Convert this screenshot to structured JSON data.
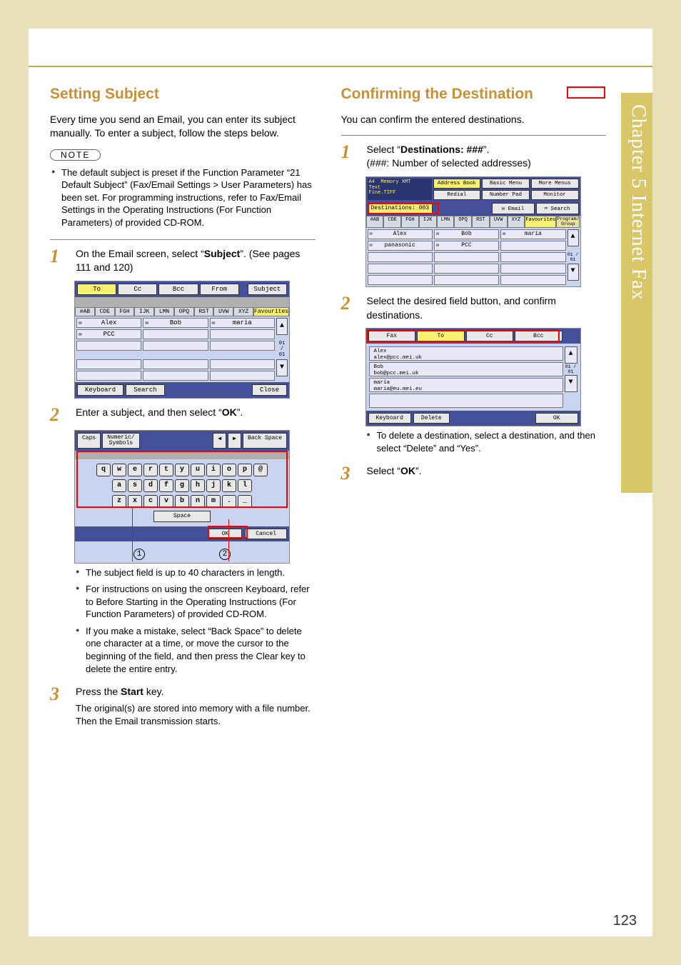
{
  "side_tab": "Chapter 5    Internet Fax",
  "page_number": "123",
  "left": {
    "heading": "Setting Subject",
    "intro": "Every time you send an Email, you can enter its subject manually. To enter a subject, follow the steps below.",
    "note_label": "NOTE",
    "note_bullets": [
      "The default subject is preset if the Function Parameter “21 Default Subject” (Fax/Email Settings > User Parameters) has been set. For programming instructions, refer to Fax/Email Settings in the Operating Instructions (For Function Parameters) of provided CD-ROM."
    ],
    "step1": {
      "num": "1",
      "text_pre": "On the Email screen, select “",
      "text_bold": "Subject",
      "text_post": "”. (See pages 111 and 120)"
    },
    "step2": {
      "num": "2",
      "text_pre": "Enter a subject, and then select “",
      "text_bold": "OK",
      "text_post": "”."
    },
    "step2_bullets": [
      "The subject field is up to 40 characters in length.",
      "For instructions on using the onscreen Keyboard, refer to Before Starting in the Operating Instructions (For Function Parameters) of provided CD-ROM.",
      "If you make a mistake, select “Back Space” to delete one character at a time, or move the cursor to the beginning of the field, and then press the Clear key to delete the entire entry."
    ],
    "step3": {
      "num": "3",
      "text_pre": "Press the ",
      "text_bold": "Start",
      "text_post": " key.",
      "sub": "The original(s) are stored into memory with a file number. Then the Email transmission starts."
    },
    "ss1": {
      "topbar": [
        "To",
        "Cc",
        "Bcc",
        "From",
        "",
        "Subject"
      ],
      "tabs": [
        "#AB",
        "CDE",
        "FGH",
        "IJK",
        "LMN",
        "OPQ",
        "RST",
        "UVW",
        "XYZ",
        "Favourites"
      ],
      "cells_row1": [
        "Alex",
        "Bob",
        "maria"
      ],
      "cells_row2": [
        "PCC",
        "",
        ""
      ],
      "counter": "01 / 01",
      "botbar_left": [
        "Keyboard",
        "Search"
      ],
      "botbar_right": "Close"
    },
    "ss2": {
      "top_left": [
        "Caps",
        "Numeric/\nSymbols"
      ],
      "top_right": [
        "◀",
        "▶",
        "Back Space"
      ],
      "rows": [
        [
          "q",
          "w",
          "e",
          "r",
          "t",
          "y",
          "u",
          "i",
          "o",
          "p",
          "@"
        ],
        [
          "a",
          "s",
          "d",
          "f",
          "g",
          "h",
          "j",
          "k",
          "l"
        ],
        [
          "z",
          "x",
          "c",
          "v",
          "b",
          "n",
          "m",
          ".",
          "_"
        ]
      ],
      "space": "Space",
      "bot": [
        "OK",
        "Cancel"
      ],
      "callouts": [
        "1",
        "2"
      ]
    }
  },
  "right": {
    "heading": "Confirming the Destination",
    "intro": "You can confirm the entered destinations.",
    "step1": {
      "num": "1",
      "text_pre": "Select “",
      "text_bold": "Destinations: ###",
      "text_post": "”.",
      "sub": "(###: Number of selected addresses)"
    },
    "step2": {
      "num": "2",
      "text": "Select the desired field button, and confirm destinations."
    },
    "step2_bullets": [
      "To delete a destination, select a destination, and then select “Delete” and “Yes”."
    ],
    "step3": {
      "num": "3",
      "text_pre": "Select “",
      "text_bold": "OK",
      "text_post": "”."
    },
    "ss3": {
      "docinfo": [
        "A4",
        "Memory XMT",
        "Text",
        "Fine.TIFF"
      ],
      "menu_row1": [
        "Address Book",
        "Basic Menu",
        "More Menus"
      ],
      "menu_row2": [
        "Redial",
        "Number Pad",
        "Monitor"
      ],
      "menu_row3_email": "Email",
      "menu_row3_search": "Search",
      "dest_label": "Destinations: 003",
      "tabs": [
        "#AB",
        "CDE",
        "FGH",
        "IJK",
        "LMN",
        "OPQ",
        "RST",
        "UVW",
        "XYZ",
        "Favourites",
        "Program/\nGroup"
      ],
      "cells_row1": [
        "Alex",
        "Bob",
        "maria"
      ],
      "cells_row2": [
        "panasonic",
        "PCC",
        ""
      ],
      "counter": "01 / 01"
    },
    "ss4": {
      "topbar": [
        "Fax",
        "To",
        "Cc",
        "Bcc"
      ],
      "entries": [
        {
          "name": "Alex",
          "addr": "alex@pcc.mei.uk"
        },
        {
          "name": "Bob",
          "addr": "bob@pcc.mei.uk"
        },
        {
          "name": "maria",
          "addr": "maria@eu.mei.eu"
        }
      ],
      "counter": "01 / 01",
      "bot_left": [
        "Keyboard",
        "Delete"
      ],
      "bot_right": "OK"
    }
  }
}
